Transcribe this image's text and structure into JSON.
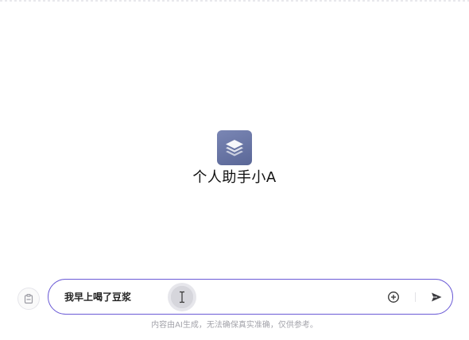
{
  "assistant": {
    "name": "个人助手小A",
    "avatar_icon": "layers-icon",
    "avatar_color": "#6a76a6"
  },
  "composer": {
    "value": "我早上喝了豆浆",
    "placeholder": "",
    "border_color": "#6b5bd6",
    "side_icon": "clipboard-icon",
    "add_icon": "plus-circle-icon",
    "send_icon": "send-icon"
  },
  "footer": {
    "disclaimer": "内容由AI生成，无法确保真实准确，仅供参考。"
  }
}
